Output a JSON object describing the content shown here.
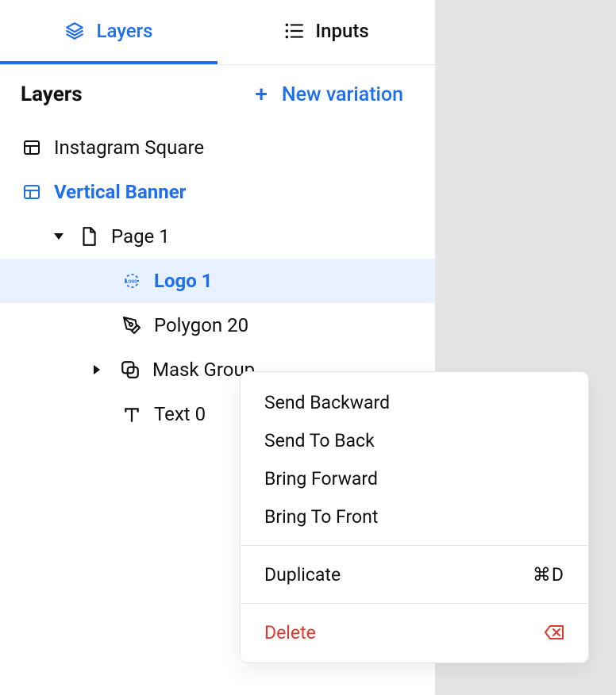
{
  "tabs": {
    "layers": "Layers",
    "inputs": "Inputs"
  },
  "section": {
    "title": "Layers",
    "new_variation": "New variation"
  },
  "tree": {
    "instagram_square": "Instagram Square",
    "vertical_banner": "Vertical Banner",
    "page1": "Page 1",
    "logo1": "Logo 1",
    "polygon20": "Polygon 20",
    "mask_group": "Mask Group",
    "text0": "Text 0"
  },
  "menu": {
    "send_backward": "Send Backward",
    "send_to_back": "Send To Back",
    "bring_forward": "Bring Forward",
    "bring_to_front": "Bring To Front",
    "duplicate": "Duplicate",
    "duplicate_shortcut": "⌘D",
    "delete": "Delete"
  }
}
